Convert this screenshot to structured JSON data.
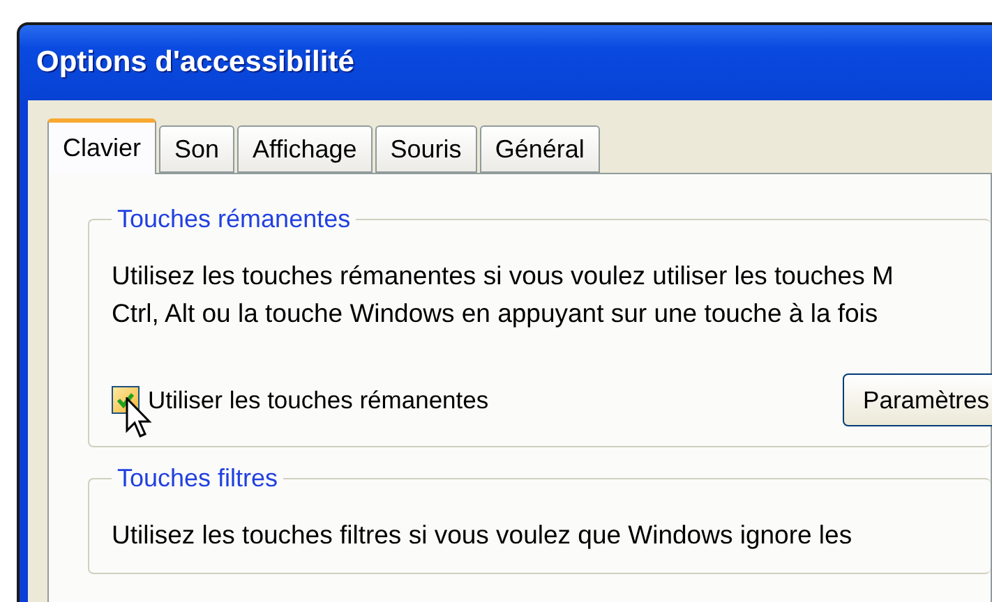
{
  "window": {
    "title": "Options d'accessibilité"
  },
  "tabs": [
    {
      "label": "Clavier",
      "selected": true
    },
    {
      "label": "Son",
      "selected": false
    },
    {
      "label": "Affichage",
      "selected": false
    },
    {
      "label": "Souris",
      "selected": false
    },
    {
      "label": "Général",
      "selected": false
    }
  ],
  "groups": [
    {
      "title": "Touches rémanentes",
      "description_lines": [
        "Utilisez les touches rémanentes si vous voulez utiliser les touches M",
        "Ctrl, Alt ou la touche Windows en appuyant sur une touche à la fois"
      ],
      "checkbox": {
        "label": "Utiliser les touches rémanentes",
        "checked": true
      },
      "button": "Paramètres"
    },
    {
      "title": "Touches filtres",
      "description_lines": [
        "Utilisez les touches filtres si vous voulez que Windows ignore les"
      ]
    }
  ]
}
